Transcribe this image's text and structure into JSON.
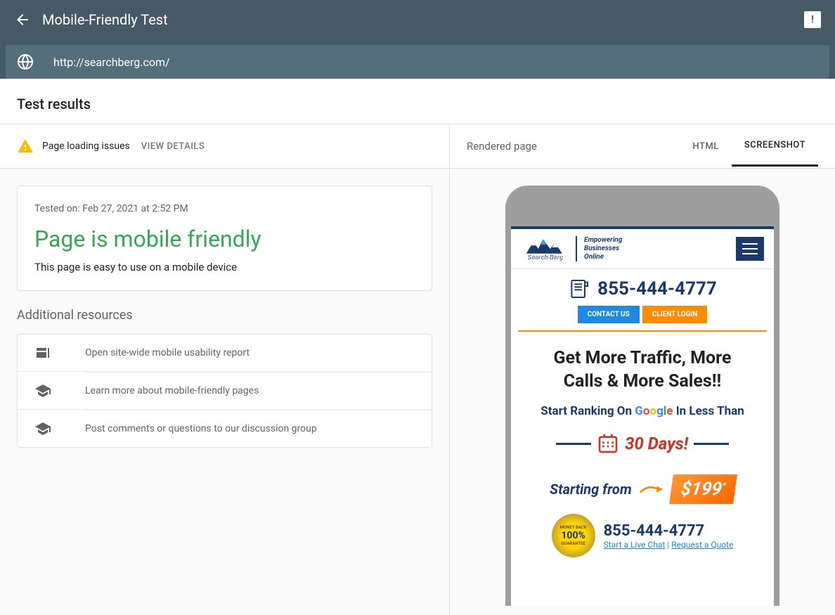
{
  "header": {
    "title": "Mobile-Friendly Test",
    "url": "http://searchberg.com/"
  },
  "results_header": "Test results",
  "issues": {
    "label": "Page loading issues",
    "view_details": "VIEW DETAILS"
  },
  "result_card": {
    "tested_on": "Tested on: Feb 27, 2021 at 2:52 PM",
    "title": "Page is mobile friendly",
    "description": "This page is easy to use on a mobile device"
  },
  "additional_resources": {
    "title": "Additional resources",
    "items": [
      "Open site-wide mobile usability report",
      "Learn more about mobile-friendly pages",
      "Post comments or questions to our discussion group"
    ]
  },
  "right": {
    "label": "Rendered page",
    "tabs": {
      "html": "HTML",
      "screenshot": "SCREENSHOT"
    }
  },
  "preview": {
    "tagline1": "Empowering",
    "tagline2": "Businesses",
    "tagline3": "Online",
    "logo_text": "Search Berg",
    "phone": "855-444-4777",
    "contact_btn": "CONTACT US",
    "login_btn": "CLIENT LOGIN",
    "hero_line1": "Get More Traffic, More",
    "hero_line2": "Calls & More Sales!!",
    "hero_sub_start": "Start Ranking On ",
    "hero_sub_end": " In Less Than",
    "days_text": "30 Days!",
    "starting_from": "Starting from",
    "price": "$199",
    "price_sup": "*",
    "footer_phone": "855-444-4777",
    "live_chat": "Start a Live Chat",
    "quote": "Request a Quote",
    "guarantee_top": "MONEY BACK",
    "guarantee_pct": "100%",
    "guarantee_bottom": "GUARANTEE"
  }
}
